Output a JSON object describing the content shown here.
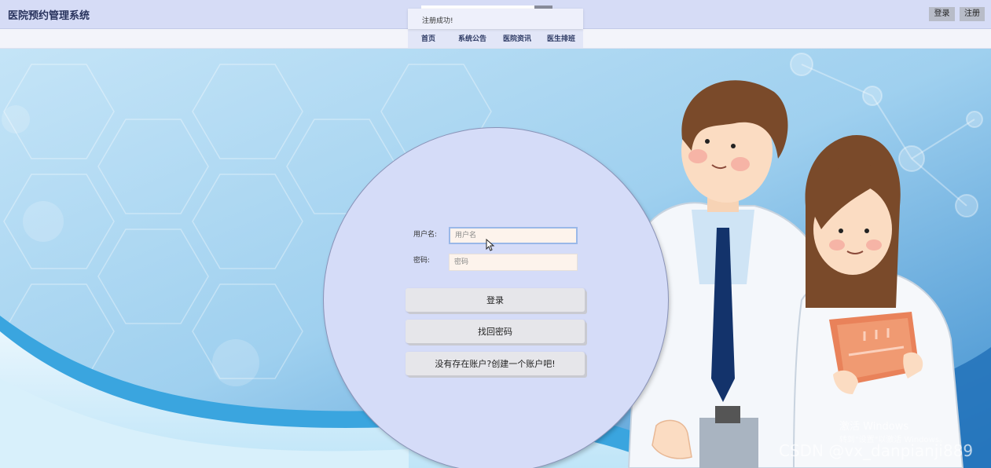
{
  "header": {
    "title": "医院预约管理系统",
    "login_label": "登录",
    "register_label": "注册"
  },
  "toast": {
    "message": "注册成功!"
  },
  "nav": {
    "items": [
      {
        "label": "首页"
      },
      {
        "label": "系统公告"
      },
      {
        "label": "医院资讯"
      },
      {
        "label": "医生排班"
      }
    ]
  },
  "form": {
    "username_label": "用户名:",
    "username_placeholder": "用户名",
    "password_label": "密码:",
    "password_placeholder": "密码",
    "login_button": "登录",
    "forgot_button": "找回密码",
    "register_button": "没有存在账户?创建一个账户吧!"
  },
  "overlay": {
    "windows_line1": "激活 Windows",
    "windows_line2": "转到\"设置\"以激活 Windows。",
    "csdn": "CSDN @vx_danpianji889"
  },
  "colors": {
    "header_bg": "#d6dcf6",
    "circle_bg": "#d5dcf8",
    "input_bg": "#fdf3ec"
  }
}
